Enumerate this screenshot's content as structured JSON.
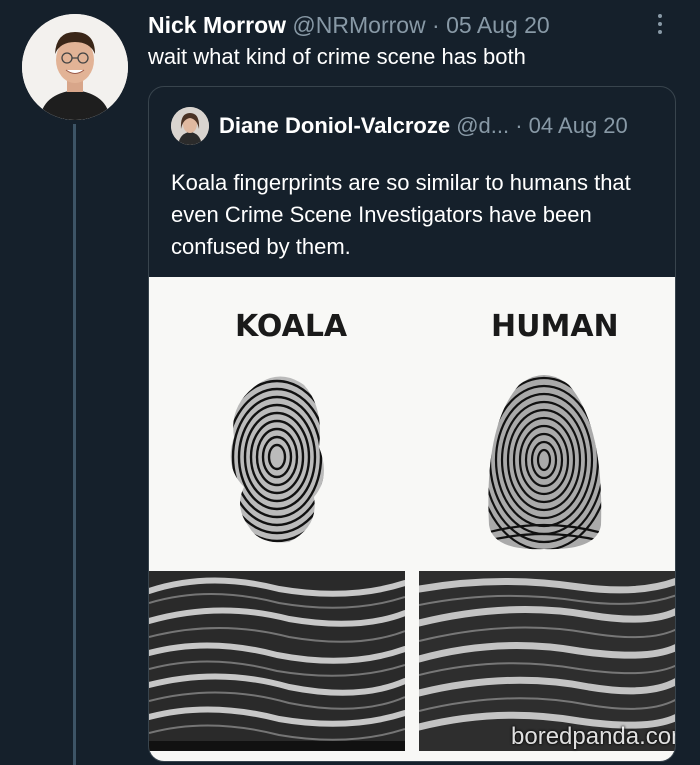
{
  "tweet": {
    "author_name": "Nick Morrow",
    "handle": "@NRMorrow",
    "separator": " · ",
    "date": "05 Aug 20",
    "text": "wait what kind of crime scene has both"
  },
  "quoted": {
    "author_name": "Diane Doniol-Valcroze",
    "handle": "@d...",
    "separator": " · ",
    "date": "04 Aug 20",
    "text": "Koala fingerprints are so similar to humans that even Crime Scene Investigators have been confused by them.",
    "image": {
      "label_left": "KOALA",
      "label_right": "HUMAN",
      "watermark": "boredpanda.com"
    }
  },
  "icons": {
    "more": "more-vertical-icon"
  },
  "colors": {
    "background": "#15202b",
    "muted": "#8899a6",
    "border": "#38444d",
    "thread_line": "#3d5466"
  }
}
